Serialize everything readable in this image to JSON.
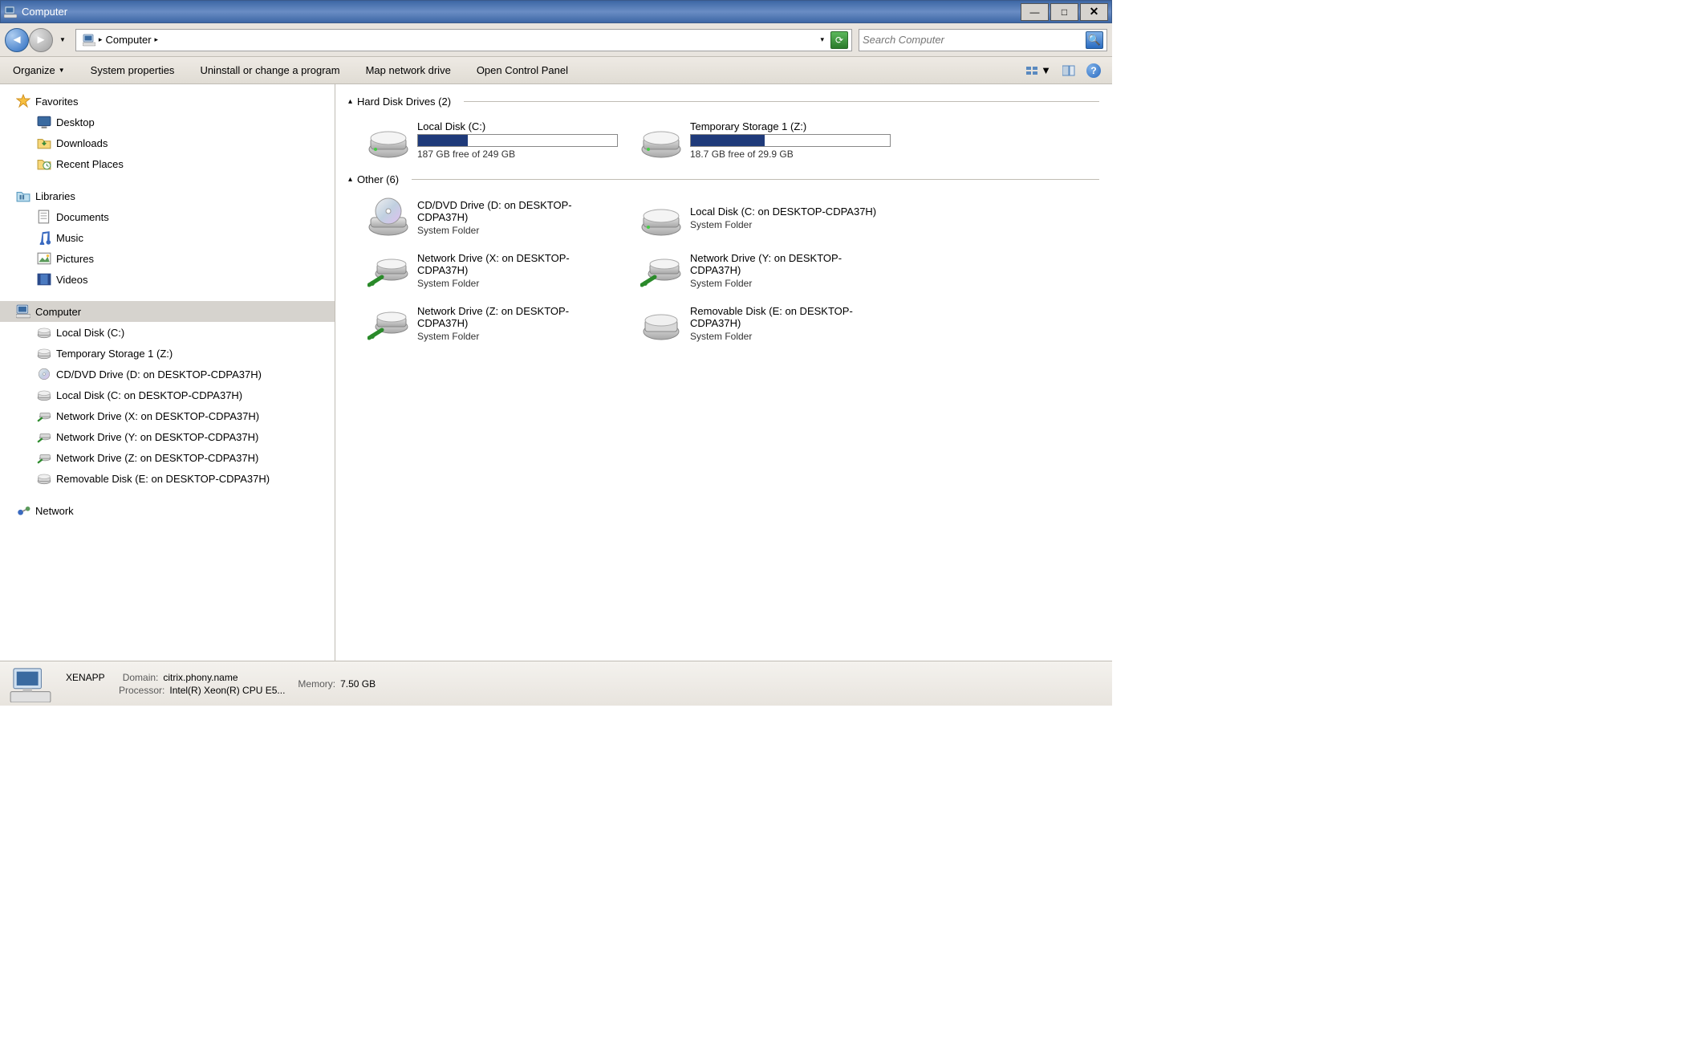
{
  "window": {
    "title": "Computer"
  },
  "nav": {
    "address_segments": [
      {
        "label": "Computer"
      }
    ],
    "search_placeholder": "Search Computer"
  },
  "toolbar": {
    "organize": "Organize",
    "items": [
      "System properties",
      "Uninstall or change a program",
      "Map network drive",
      "Open Control Panel"
    ]
  },
  "sidebar": {
    "favorites": {
      "label": "Favorites",
      "items": [
        "Desktop",
        "Downloads",
        "Recent Places"
      ]
    },
    "libraries": {
      "label": "Libraries",
      "items": [
        "Documents",
        "Music",
        "Pictures",
        "Videos"
      ]
    },
    "computer": {
      "label": "Computer",
      "items": [
        "Local Disk (C:)",
        "Temporary Storage 1 (Z:)",
        "CD/DVD Drive (D: on DESKTOP-CDPA37H)",
        "Local Disk (C: on DESKTOP-CDPA37H)",
        "Network Drive (X: on DESKTOP-CDPA37H)",
        "Network Drive (Y: on DESKTOP-CDPA37H)",
        "Network Drive (Z: on DESKTOP-CDPA37H)",
        "Removable Disk (E: on DESKTOP-CDPA37H)"
      ]
    },
    "network": {
      "label": "Network"
    }
  },
  "content": {
    "groups": {
      "hdd": {
        "label": "Hard Disk Drives (2)",
        "drives": [
          {
            "name": "Local Disk (C:)",
            "free": "187 GB free of 249 GB",
            "fill": 25
          },
          {
            "name": "Temporary Storage 1 (Z:)",
            "free": "18.7 GB free of 29.9 GB",
            "fill": 37
          }
        ]
      },
      "other": {
        "label": "Other (6)",
        "items": [
          {
            "name": "CD/DVD Drive (D: on DESKTOP-CDPA37H)",
            "sub": "System Folder",
            "icon": "cd"
          },
          {
            "name": "Local Disk (C: on DESKTOP-CDPA37H)",
            "sub": "System Folder",
            "icon": "hdd"
          },
          {
            "name": "Network Drive (X: on DESKTOP-CDPA37H)",
            "sub": "System Folder",
            "icon": "net"
          },
          {
            "name": "Network Drive (Y: on DESKTOP-CDPA37H)",
            "sub": "System Folder",
            "icon": "net"
          },
          {
            "name": "Network Drive (Z: on DESKTOP-CDPA37H)",
            "sub": "System Folder",
            "icon": "net"
          },
          {
            "name": "Removable Disk (E: on DESKTOP-CDPA37H)",
            "sub": "System Folder",
            "icon": "removable"
          }
        ]
      }
    }
  },
  "details": {
    "name": "XENAPP",
    "domain_label": "Domain:",
    "domain": "citrix.phony.name",
    "processor_label": "Processor:",
    "processor": "Intel(R) Xeon(R) CPU E5...",
    "memory_label": "Memory:",
    "memory": "7.50 GB"
  }
}
